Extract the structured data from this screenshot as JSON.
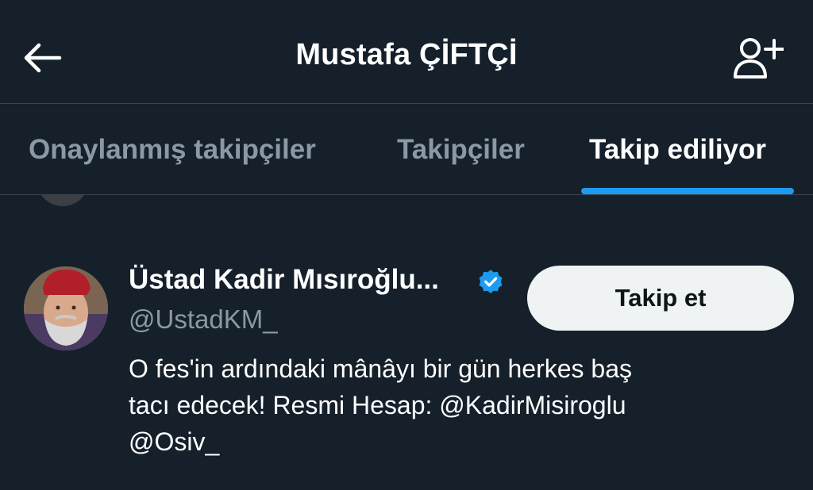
{
  "header": {
    "title": "Mustafa ÇİFTÇİ",
    "back_icon": "arrow-left-icon",
    "add_user_icon": "person-plus-icon"
  },
  "tabs": [
    {
      "label": "Onaylanmış takipçiler",
      "active": false
    },
    {
      "label": "Takipçiler",
      "active": false
    },
    {
      "label": "Takip ediliyor",
      "active": true
    }
  ],
  "user": {
    "display_name": "Üstad Kadir Mısıroğlu...",
    "handle": "@UstadKM_",
    "verified": true,
    "follow_label": "Takip et",
    "bio_line1": "O fes'in ardındaki mânâyı bir gün herkes baş",
    "bio_line2": "tacı edecek! Resmi Hesap: @KadirMisiroglu",
    "bio_line3": "@Osiv_"
  },
  "colors": {
    "background": "#15202b",
    "accent": "#1d9bf0",
    "secondary_text": "#8b98a5",
    "divider": "#38444d",
    "button_bg": "#eff3f4"
  }
}
